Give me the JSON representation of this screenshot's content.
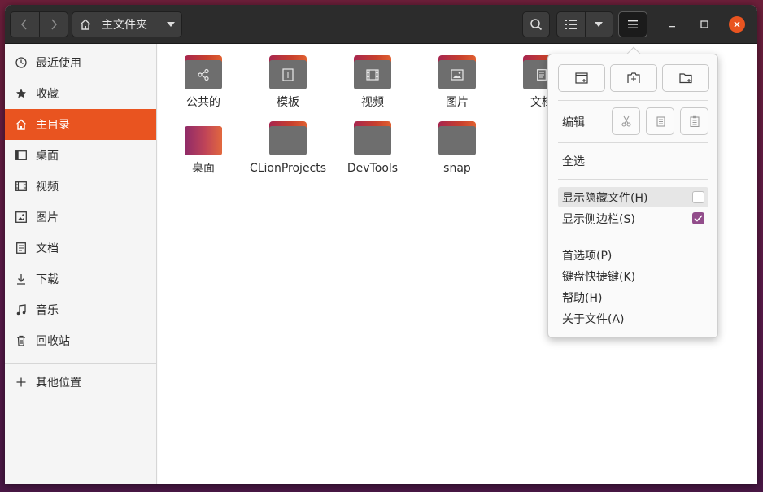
{
  "headerbar": {
    "path_label": "主文件夹",
    "icons": {
      "back": "chevron-left-icon",
      "forward": "chevron-right-icon",
      "home": "home-icon",
      "path_dropdown": "dropdown-arrow-icon",
      "search": "search-icon",
      "list_view": "list-view-icon",
      "view_dropdown": "dropdown-arrow-icon",
      "menu": "hamburger-menu-icon",
      "minimize": "minimize-icon",
      "maximize": "maximize-icon",
      "close": "close-icon"
    },
    "close_color": "#e95420"
  },
  "sidebar": {
    "accent": "#e95420",
    "items": [
      {
        "label": "最近使用",
        "icon": "clock-icon"
      },
      {
        "label": "收藏",
        "icon": "star-icon"
      },
      {
        "label": "主目录",
        "icon": "home-icon",
        "active": true
      },
      {
        "label": "桌面",
        "icon": "desktop-icon"
      },
      {
        "label": "视频",
        "icon": "film-icon"
      },
      {
        "label": "图片",
        "icon": "image-icon"
      },
      {
        "label": "文档",
        "icon": "document-icon"
      },
      {
        "label": "下载",
        "icon": "download-icon"
      },
      {
        "label": "音乐",
        "icon": "music-icon"
      },
      {
        "label": "回收站",
        "icon": "trash-icon"
      }
    ],
    "other_locations": {
      "label": "其他位置",
      "icon": "plus-icon"
    }
  },
  "files": [
    {
      "name": "公共的",
      "icon": "share-icon"
    },
    {
      "name": "模板",
      "icon": "template-icon"
    },
    {
      "name": "视频",
      "icon": "film-icon"
    },
    {
      "name": "图片",
      "icon": "image-icon"
    },
    {
      "name": "文档",
      "icon": "document-icon"
    },
    {
      "name": "桌面",
      "icon": "desktop-folder"
    },
    {
      "name": "CLionProjects",
      "icon": "folder"
    },
    {
      "name": "DevTools",
      "icon": "folder"
    },
    {
      "name": "snap",
      "icon": "folder"
    }
  ],
  "menu": {
    "top_buttons": [
      "new-window-icon",
      "new-tab-icon",
      "new-folder-icon"
    ],
    "edit_label": "编辑",
    "edit_buttons": [
      "cut-icon",
      "copy-icon",
      "paste-icon"
    ],
    "select_all": "全选",
    "show_hidden": {
      "label": "显示隐藏文件(H)",
      "checked": false
    },
    "show_sidebar": {
      "label": "显示侧边栏(S)",
      "checked": true
    },
    "preferences": "首选项(P)",
    "shortcuts": "键盘快捷键(K)",
    "help": "帮助(H)",
    "about": "关于文件(A)",
    "check_color": "#924d8b"
  }
}
